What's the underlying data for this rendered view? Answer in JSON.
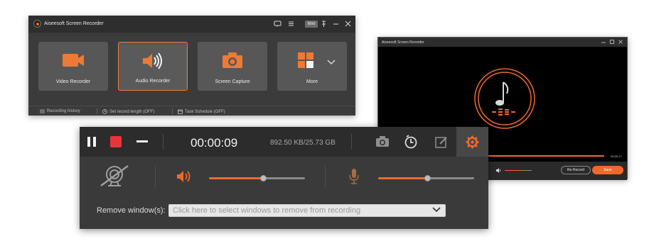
{
  "main_window": {
    "title": "Aiseesoft Screen Recorder",
    "mini_label": "Mini",
    "tiles": [
      {
        "label": "Video Recorder",
        "icon": "video-camera-icon",
        "selected": false
      },
      {
        "label": "Audio Recorder",
        "icon": "speaker-icon",
        "selected": true
      },
      {
        "label": "Screen Capture",
        "icon": "camera-icon",
        "selected": false
      },
      {
        "label": "More",
        "icon": "grid-icon",
        "selected": false
      }
    ],
    "footer": {
      "history": "Recording history",
      "record_length": "Set record length (OFF)",
      "task_schedule": "Task Schedule (OFF)"
    }
  },
  "player_window": {
    "title": "Aiseesoft Screen Recorder",
    "time": "00:00:17",
    "rerecord_label": "Re-Record",
    "save_label": "Save",
    "progress": 1.0,
    "volume": 0.6
  },
  "recording_bar": {
    "time": "00:00:09",
    "size": "892.50 KB/25.73 GB",
    "system_volume": 0.57,
    "mic_volume": 0.52,
    "remove_label": "Remove window(s):",
    "remove_placeholder": "Click here to select windows to remove from recording"
  },
  "colors": {
    "accent": "#ee6a2c",
    "record_red": "#e8353a",
    "dark_bg": "#3a3a3a",
    "title_bg": "#2e2e2e"
  }
}
